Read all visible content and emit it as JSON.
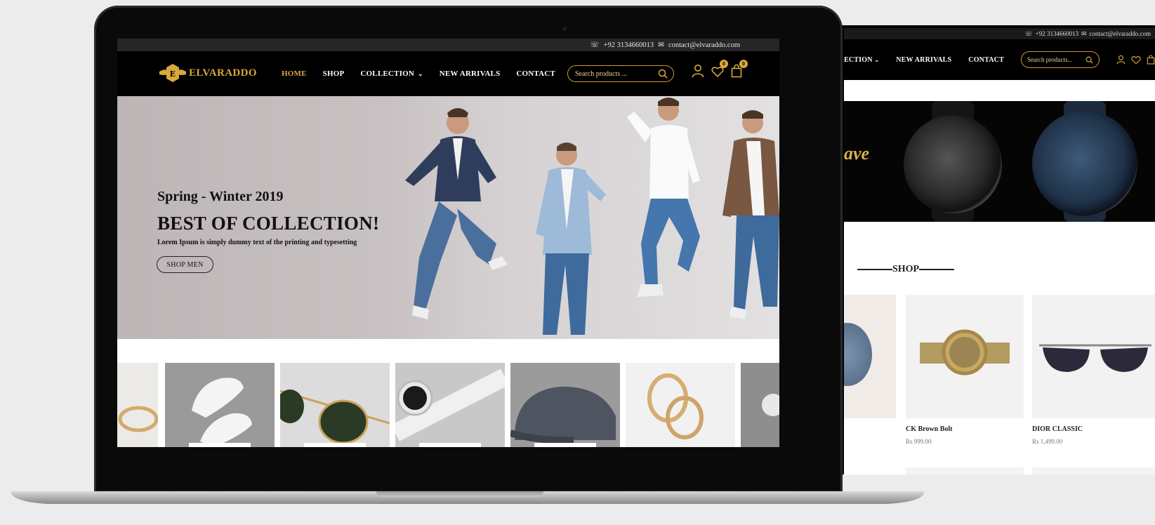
{
  "site": {
    "brand": "ELVARADDO",
    "phone": "+92 3134660013",
    "email": "contact@elvaraddo.com"
  },
  "nav": {
    "items": [
      {
        "label": "HOME",
        "active": true
      },
      {
        "label": "SHOP",
        "active": false
      },
      {
        "label": "COLLECTION",
        "active": false,
        "dropdown": true
      },
      {
        "label": "NEW ARRIVALS",
        "active": false
      },
      {
        "label": "CONTACT",
        "active": false
      }
    ],
    "search_placeholder": "Search products ...",
    "wishlist_count": "0",
    "cart_count": "0"
  },
  "hero": {
    "subtitle": "Spring - Winter 2019",
    "title": "BEST OF COLLECTION!",
    "description": "Lorem Ipsum is simply dummy text of the printing and typesetting",
    "button": "SHOP MEN"
  },
  "category_strip": [
    "bracelet",
    "sneakers",
    "sunglasses",
    "smartwatch",
    "cap",
    "bangles",
    "watch"
  ],
  "secondary_screen": {
    "nav_items": [
      "ECTION",
      "NEW ARRIVALS",
      "CONTACT"
    ],
    "search_placeholder": "Search products...",
    "banner_script": "ave",
    "shop_title": "SHOP",
    "products": [
      {
        "name": "CK Brown Bolt",
        "price": "Rs 999.00"
      },
      {
        "name": "DIOR CLASSIC",
        "price": "Rs 1,499.00"
      }
    ]
  },
  "colors": {
    "gold": "#d8a93b",
    "nav_bg": "#000000",
    "topbar_bg": "#262626",
    "hero_bg": "#c8c1c2"
  }
}
